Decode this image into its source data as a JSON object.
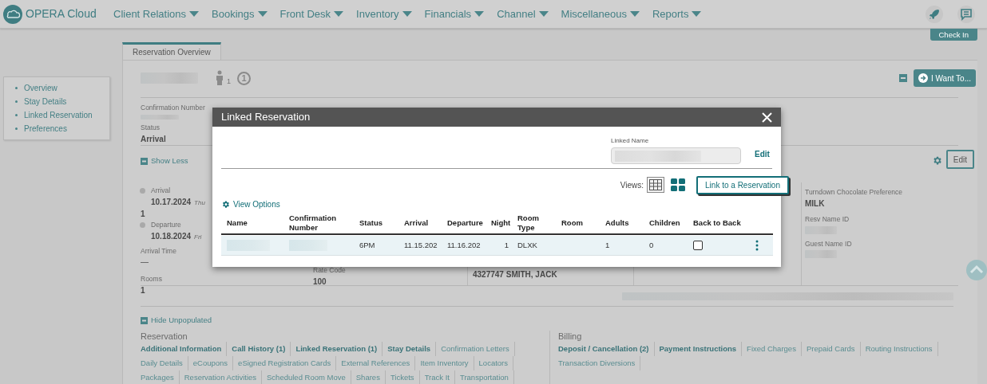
{
  "nav": {
    "product": "OPERA Cloud",
    "menus": [
      "Client Relations",
      "Bookings",
      "Front Desk",
      "Inventory",
      "Financials",
      "Channel",
      "Miscellaneous",
      "Reports"
    ]
  },
  "check_in": "Check In",
  "sidebar": {
    "items": [
      "Overview",
      "Stay Details",
      "Linked Reservation",
      "Preferences"
    ]
  },
  "tabs": [
    {
      "label": "Reservation Overview",
      "selected": true
    }
  ],
  "guest": {
    "adults": "1",
    "indicator": "1"
  },
  "i_want_to": "I Want To...",
  "summary": {
    "labels": [
      "Confirmation Number"
    ],
    "status_label": "Status",
    "status": "Arrival"
  },
  "show_less": "Show Less",
  "edit": "Edit",
  "stay": {
    "arrival_label": "Arrival",
    "arrival_date": "10.17.2024",
    "arrival_day": "Thu",
    "nights": "1",
    "departure_label": "Departure",
    "departure_date": "10.18.2024",
    "departure_day": "Fri",
    "arrival_time_label": "Arrival Time",
    "arrival_time": "—",
    "rooms_label": "Rooms",
    "rooms": "1",
    "rate_code_label": "Rate Code",
    "rate_code": "100",
    "profile": "4327747 SMITH, JACK"
  },
  "preferences": [
    {
      "label": "Turndown Chocolate Preference",
      "value": "MILK"
    },
    {
      "label": "Resv Name ID"
    },
    {
      "label": "Guest Name ID"
    }
  ],
  "hide_unpopulated": "Hide Unpopulated",
  "sections": [
    {
      "title": "Reservation",
      "links": [
        {
          "label": "Additional Information",
          "populated": true
        },
        {
          "label": "Call History (1)",
          "populated": true
        },
        {
          "label": "Linked Reservation (1)",
          "populated": true
        },
        {
          "label": "Stay Details",
          "populated": true
        },
        {
          "label": "Confirmation Letters",
          "populated": false
        },
        {
          "label": "Daily Details",
          "populated": false
        },
        {
          "label": "eCoupons",
          "populated": false
        },
        {
          "label": "eSigned Registration Cards",
          "populated": false
        },
        {
          "label": "External References",
          "populated": false
        },
        {
          "label": "Item Inventory",
          "populated": false
        },
        {
          "label": "Locators",
          "populated": false
        },
        {
          "label": "Packages",
          "populated": false
        },
        {
          "label": "Reservation Activities",
          "populated": false
        },
        {
          "label": "Scheduled Room Move",
          "populated": false
        },
        {
          "label": "Shares",
          "populated": false
        },
        {
          "label": "Tickets",
          "populated": false
        },
        {
          "label": "Track It",
          "populated": false
        },
        {
          "label": "Transportation",
          "populated": false
        }
      ]
    },
    {
      "title": "Billing",
      "links": [
        {
          "label": "Deposit / Cancellation (2)",
          "populated": true
        },
        {
          "label": "Payment Instructions",
          "populated": true
        },
        {
          "label": "Fixed Charges",
          "populated": false
        },
        {
          "label": "Prepaid Cards",
          "populated": false
        },
        {
          "label": "Routing Instructions",
          "populated": false
        },
        {
          "label": "Transaction Diversions",
          "populated": false
        }
      ]
    }
  ],
  "modal": {
    "title": "Linked Reservation",
    "linked_name_label": "Linked Name",
    "edit": "Edit",
    "views_label": "Views:",
    "views": [
      {
        "kind": "table",
        "selected": true
      },
      {
        "kind": "tiles",
        "selected": false
      }
    ],
    "link_button": "Link to a Reservation",
    "view_options": "View Options",
    "columns": [
      "Name",
      "Confirmation Number",
      "Status",
      "Arrival",
      "Departure",
      "Night",
      "Room Type",
      "Room",
      "Adults",
      "Children",
      "Back to Back"
    ],
    "rows": [
      {
        "status": "6PM",
        "arrival": "11.15.202",
        "departure": "11.16.202",
        "nights": "1",
        "room_type": "DLXK",
        "adults": "1",
        "children": "0",
        "back_to_back": false
      }
    ]
  }
}
